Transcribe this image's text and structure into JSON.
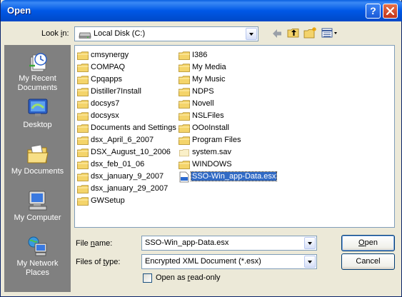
{
  "window": {
    "title": "Open"
  },
  "titlebar": {
    "help_icon": "?",
    "close_icon": "close"
  },
  "lookin": {
    "label_pre": "Look ",
    "label_key": "i",
    "label_post": "n:",
    "value": "Local Disk (C:)",
    "icon": "drive-icon"
  },
  "toolbar": {
    "back_icon": "back-arrow-icon",
    "up_icon": "up-folder-icon",
    "new_folder_icon": "new-folder-icon",
    "views_icon": "views-menu-icon"
  },
  "places": [
    {
      "label": "My Recent\nDocuments",
      "icon": "recent-documents-icon"
    },
    {
      "label": "Desktop",
      "icon": "desktop-icon"
    },
    {
      "label": "My Documents",
      "icon": "my-documents-icon"
    },
    {
      "label": "My Computer",
      "icon": "my-computer-icon"
    },
    {
      "label": "My Network\nPlaces",
      "icon": "network-places-icon"
    }
  ],
  "files": {
    "column1": [
      "cmsynergy",
      "COMPAQ",
      "Cpqapps",
      "Distiller7Install",
      "docsys7",
      "docsysx",
      "Documents and Settings",
      "dsx_April_6_2007",
      "DSX_August_10_2006",
      "dsx_feb_01_06",
      "dsx_january_9_2007",
      "dsx_january_29_2007",
      "GWSetup"
    ],
    "column2": [
      "I386",
      "My Media",
      "My Music",
      "NDPS",
      "Novell",
      "NSLFiles",
      "OOoInstall",
      "Program Files",
      "system.sav",
      "WINDOWS",
      "SSO-Win_app-Data.esx"
    ],
    "selected": "SSO-Win_app-Data.esx"
  },
  "filename": {
    "label_pre": "File ",
    "label_key": "n",
    "label_post": "ame:",
    "value": "SSO-Win_app-Data.esx"
  },
  "filetype": {
    "label_pre": "Files of ",
    "label_key": "t",
    "label_post": "ype:",
    "value": "Encrypted XML Document (*.esx)"
  },
  "readonly": {
    "label_pre": "Open as ",
    "label_key": "r",
    "label_post": "ead-only",
    "checked": false
  },
  "buttons": {
    "open_key": "O",
    "open_rest": "pen",
    "cancel": "Cancel"
  },
  "colors": {
    "title_bar": "#0058e6",
    "selection": "#316ac5",
    "places_bar": "#808080",
    "folder": "#f4d46a"
  }
}
